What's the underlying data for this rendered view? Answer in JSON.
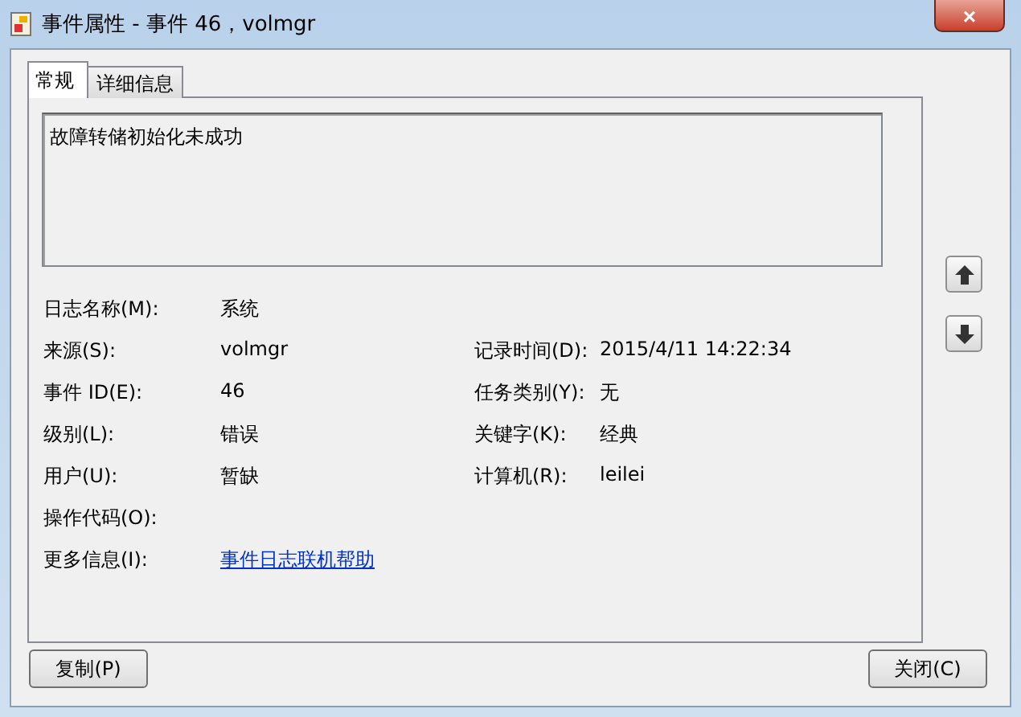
{
  "window": {
    "title": "事件属性 - 事件 46，volmgr",
    "close": "×"
  },
  "tabs": [
    {
      "label": "常规",
      "selected": true
    },
    {
      "label": "详细信息",
      "selected": false
    }
  ],
  "description": "故障转储初始化未成功",
  "rows": [
    {
      "left": {
        "label": "日志名称(M):",
        "value": "系统"
      }
    },
    {
      "left": {
        "label": "来源(S):",
        "value": "volmgr"
      },
      "right": {
        "label": "记录时间(D):",
        "value": "2015/4/11 14:22:34"
      }
    },
    {
      "left": {
        "label": "事件 ID(E):",
        "value": "46"
      },
      "right": {
        "label": "任务类别(Y):",
        "value": "无"
      }
    },
    {
      "left": {
        "label": "级别(L):",
        "value": "错误"
      },
      "right": {
        "label": "关键字(K):",
        "value": "经典"
      }
    },
    {
      "left": {
        "label": "用户(U):",
        "value": "暂缺"
      },
      "right": {
        "label": "计算机(R):",
        "value": "leilei"
      }
    },
    {
      "left": {
        "label": "操作代码(O):"
      }
    },
    {
      "left": {
        "label": "更多信息(I):",
        "value": "事件日志联机帮助",
        "kind": "link"
      }
    }
  ],
  "buttons": [
    "复制(P)",
    "关闭(C)"
  ]
}
